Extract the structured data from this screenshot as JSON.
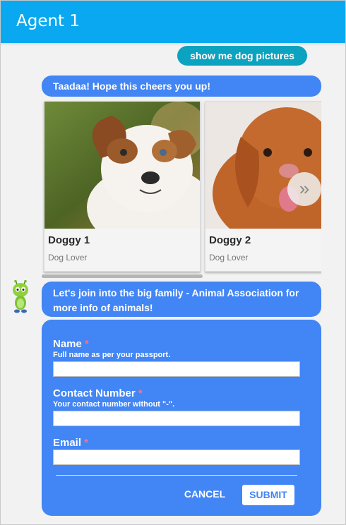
{
  "header": {
    "title": "Agent 1",
    "background": "#0aa8f0"
  },
  "conversation": {
    "user_message": "show me dog pictures",
    "bot_message_1": "Taadaa! Hope this cheers you up!",
    "carousel": {
      "cards": [
        {
          "title": "Doggy 1",
          "subtitle": "Dog Lover"
        },
        {
          "title": "Doggy 2",
          "subtitle": "Dog Lover"
        }
      ],
      "next_icon": "»"
    },
    "bot_message_2": "Let's join into the big family - Animal Association for more info of animals!"
  },
  "form": {
    "fields": [
      {
        "label": "Name",
        "required_mark": "*",
        "hint": "Full name as per your passport.",
        "value": ""
      },
      {
        "label": "Contact Number",
        "required_mark": "*",
        "hint": "Your contact number without \"-\".",
        "value": ""
      },
      {
        "label": "Email",
        "required_mark": "*",
        "hint": "",
        "value": ""
      }
    ],
    "cancel_label": "CANCEL",
    "submit_label": "SUBMIT"
  },
  "colors": {
    "bot_bubble": "#4285f4",
    "user_bubble": "#0ba3c0",
    "required": "#ff6f8a"
  }
}
